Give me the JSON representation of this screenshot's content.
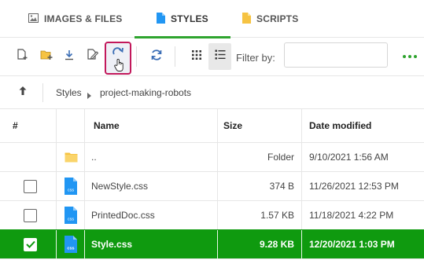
{
  "tabs": [
    {
      "label": "IMAGES & FILES",
      "icon": "image-icon",
      "active": false
    },
    {
      "label": "STYLES",
      "icon": "css-file-icon",
      "active": true
    },
    {
      "label": "SCRIPTS",
      "icon": "script-file-icon",
      "active": false
    }
  ],
  "toolbar": {
    "buttons": [
      "new-file-icon",
      "new-folder-icon",
      "download-icon",
      "edit-icon",
      "redo-icon",
      "refresh-icon",
      "grid-view-icon",
      "list-view-icon"
    ],
    "filter_label": "Filter by:",
    "filter_value": "",
    "more_icon": "more-dots-icon"
  },
  "breadcrumb": {
    "items": [
      "Styles",
      "project-making-robots"
    ]
  },
  "table": {
    "headers": {
      "select": "#",
      "name": "Name",
      "size": "Size",
      "date": "Date modified"
    },
    "rows": [
      {
        "name": "..",
        "size": "Folder",
        "date": "9/10/2021 1:56 AM",
        "type": "folder",
        "checkbox": false,
        "selected": false
      },
      {
        "name": "NewStyle.css",
        "size": "374 B",
        "date": "11/26/2021 12:53 PM",
        "type": "css",
        "checkbox": true,
        "selected": false
      },
      {
        "name": "PrintedDoc.css",
        "size": "1.57 KB",
        "date": "11/18/2021 4:22 PM",
        "type": "css",
        "checkbox": true,
        "selected": false
      },
      {
        "name": "Style.css",
        "size": "9.28 KB",
        "date": "12/20/2021 1:03 PM",
        "type": "css",
        "checkbox": true,
        "selected": true
      }
    ],
    "file_badge": "css"
  },
  "colors": {
    "accent": "#2ea42e",
    "selected_row": "#0f9a0f",
    "focus_border": "#c2185b",
    "file_blue": "#2196f3",
    "folder_yellow": "#f6c342"
  }
}
